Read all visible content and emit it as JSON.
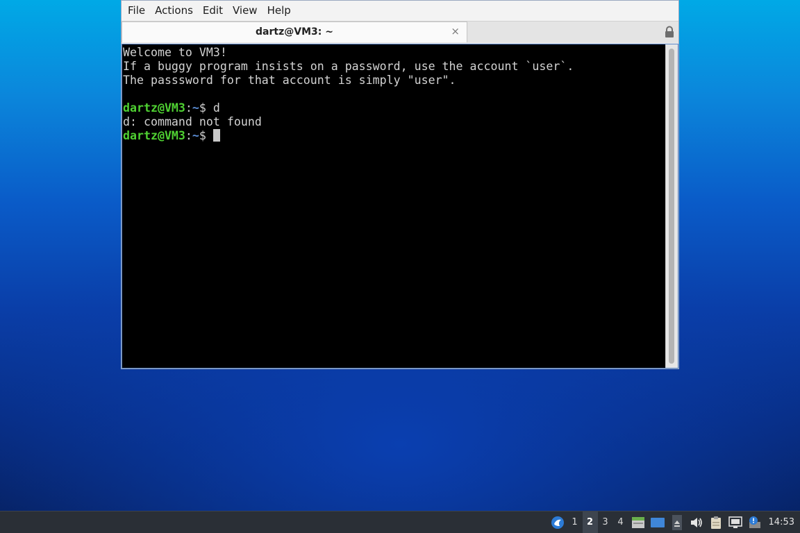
{
  "menu": [
    "File",
    "Actions",
    "Edit",
    "View",
    "Help"
  ],
  "tab": {
    "title": "dartz@VM3: ~",
    "close_glyph": "×"
  },
  "terminal": {
    "welcome_lines": [
      "Welcome to VM3!",
      "If a buggy program insists on a password, use the account `user`.",
      "The passsword for that account is simply \"user\"."
    ],
    "prompt_user": "dartz@VM3",
    "prompt_sep": ":",
    "prompt_path": "~",
    "prompt_symbol": "$ ",
    "command": "d",
    "output": "d: command not found"
  },
  "taskbar": {
    "workspaces": [
      "1",
      "2",
      "3",
      "4"
    ],
    "active_workspace": "2",
    "clock": "14:53"
  },
  "icons": {
    "menu": "distro-menu-icon",
    "tray": [
      "file-manager-icon",
      "show-desktop-icon",
      "tray-expand-icon",
      "volume-icon",
      "clipboard-icon",
      "network-icon",
      "notification-icon"
    ],
    "lock": "lock-icon"
  },
  "colors": {
    "prompt_user": "#4fd132",
    "prompt_path": "#5b8ed6",
    "terminal_bg": "#000000",
    "terminal_fg": "#d3d3d3",
    "taskbar_bg": "#2a2f36"
  }
}
